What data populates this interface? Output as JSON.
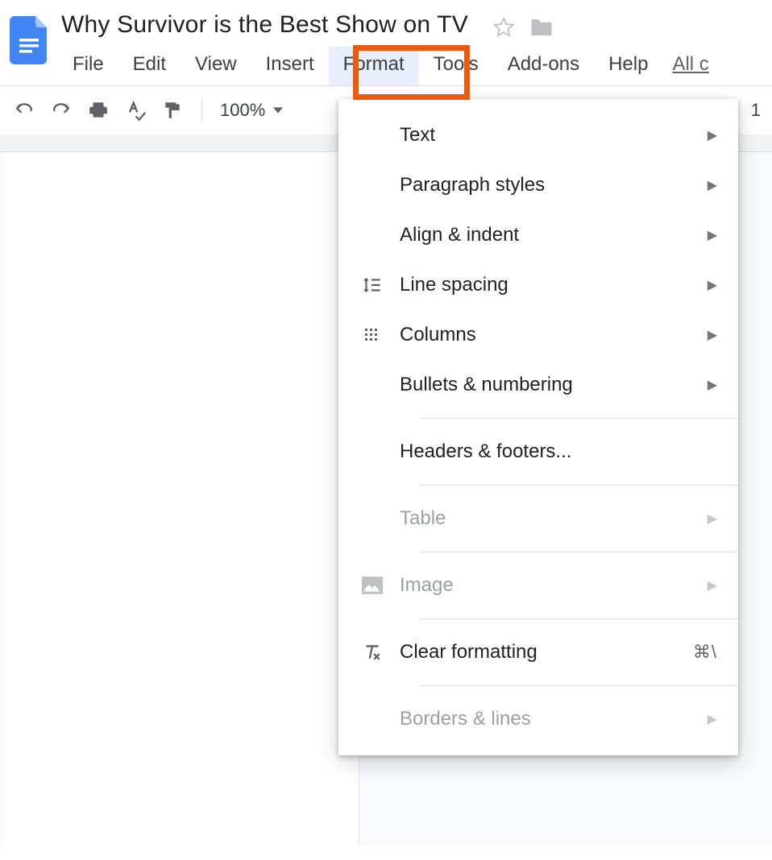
{
  "document": {
    "title": "Why Survivor is the Best Show on TV"
  },
  "menubar": {
    "items": [
      {
        "label": "File"
      },
      {
        "label": "Edit"
      },
      {
        "label": "View"
      },
      {
        "label": "Insert"
      },
      {
        "label": "Format"
      },
      {
        "label": "Tools"
      },
      {
        "label": "Add-ons"
      },
      {
        "label": "Help"
      }
    ],
    "all_changes": "All c"
  },
  "toolbar": {
    "zoom": "100%",
    "ruler_value": "1"
  },
  "format_menu": {
    "text": "Text",
    "paragraph_styles": "Paragraph styles",
    "align_indent": "Align & indent",
    "line_spacing": "Line spacing",
    "columns": "Columns",
    "bullets_numbering": "Bullets & numbering",
    "headers_footers": "Headers & footers...",
    "table": "Table",
    "image": "Image",
    "clear_formatting": "Clear formatting",
    "clear_shortcut": "⌘\\",
    "borders_lines": "Borders & lines"
  }
}
